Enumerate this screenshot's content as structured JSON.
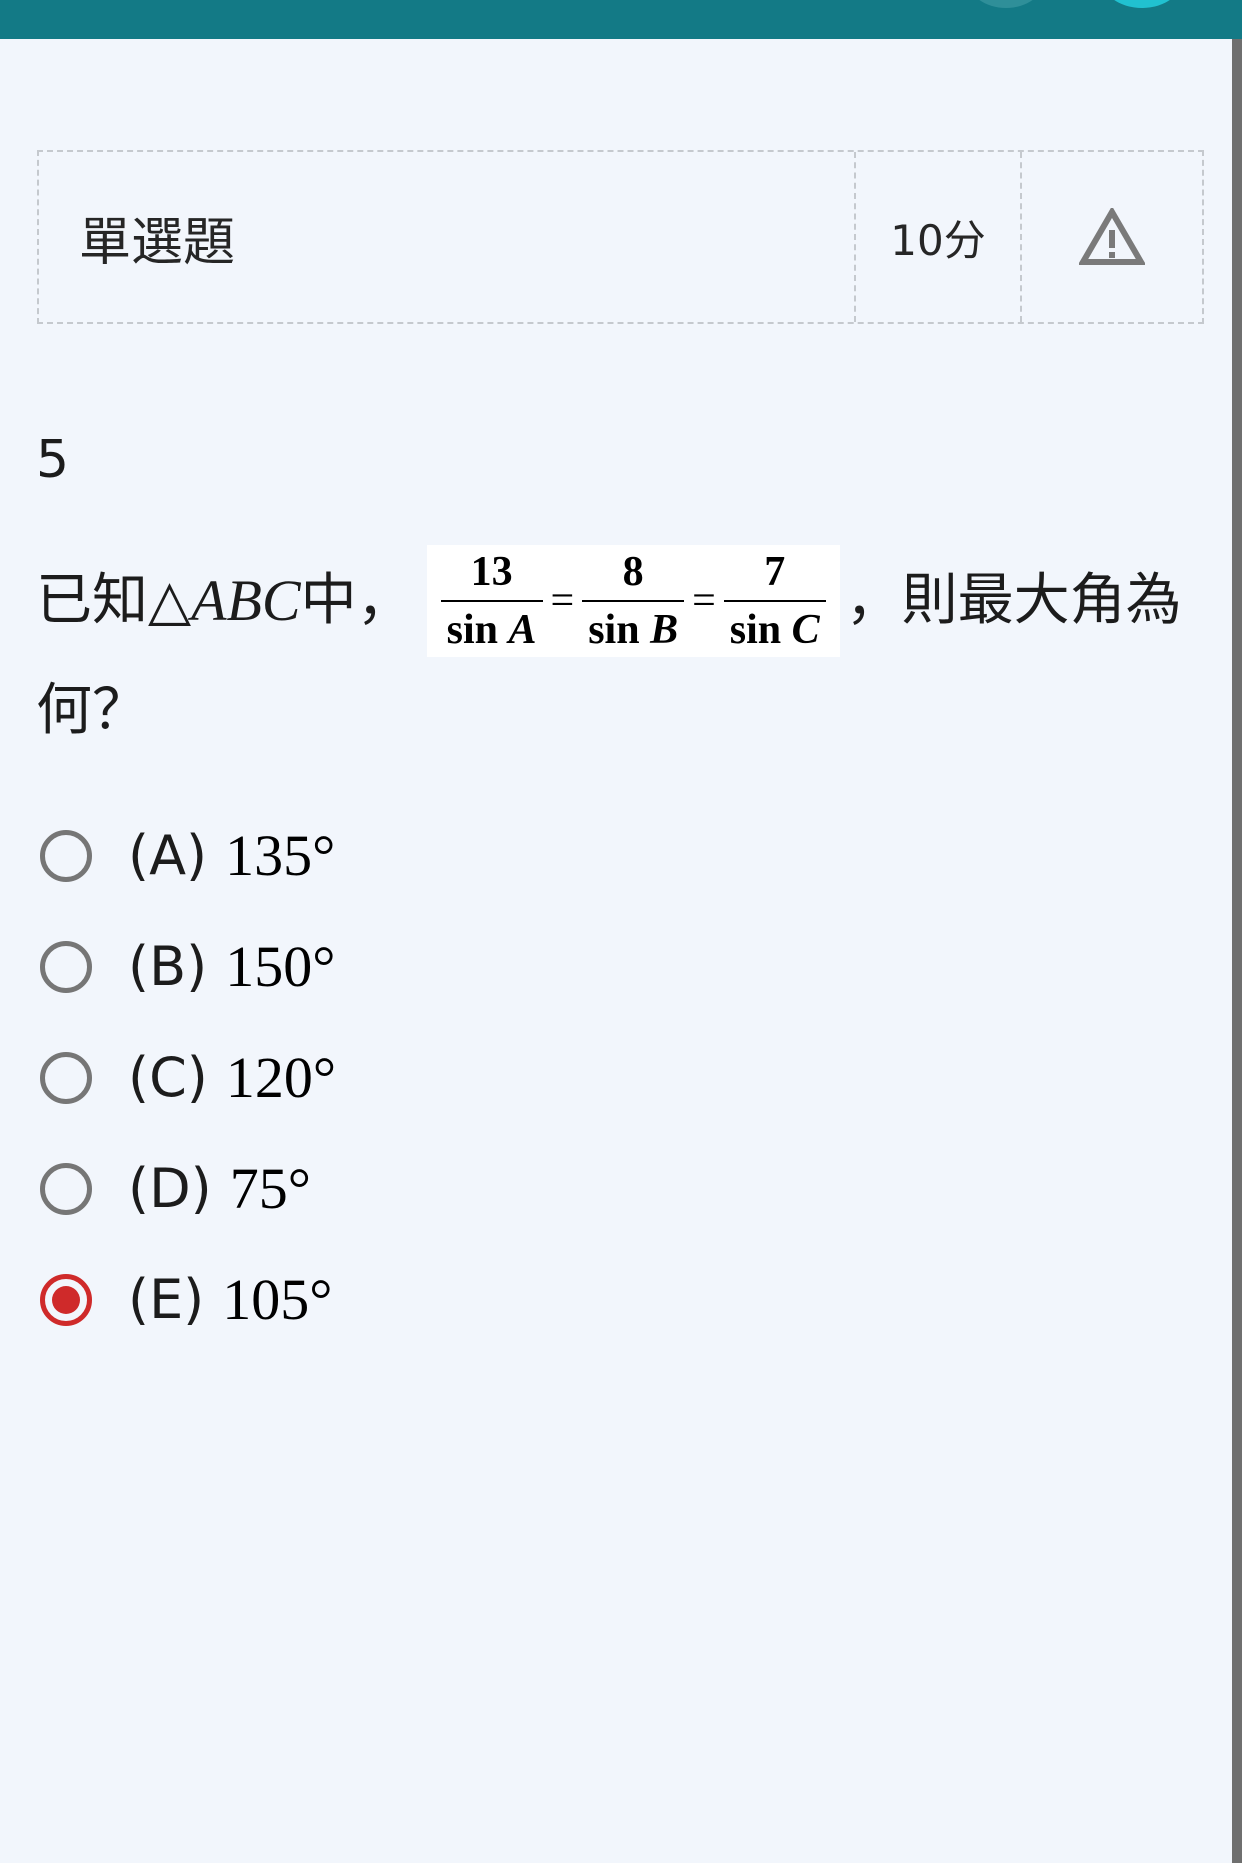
{
  "top_bar": {
    "accent_color": "#137a86"
  },
  "question_header": {
    "type_label": "單選題",
    "score": "10分",
    "report_icon": "warning-triangle-icon"
  },
  "question": {
    "number": "5",
    "text_prefix": "已知",
    "triangle_symbol": "△",
    "triangle_name": "ABC",
    "text_mid": "中，",
    "formula": {
      "fractions": [
        {
          "numerator": "13",
          "denominator_fn": "sin",
          "denominator_var": "A"
        },
        {
          "numerator": "8",
          "denominator_fn": "sin",
          "denominator_var": "B"
        },
        {
          "numerator": "7",
          "denominator_fn": "sin",
          "denominator_var": "C"
        }
      ],
      "equals": "="
    },
    "text_suffix_line1": "，則最大角為",
    "text_line2": "何？"
  },
  "options": [
    {
      "label": "(A)",
      "value": "135°",
      "selected": false
    },
    {
      "label": "(B)",
      "value": "150°",
      "selected": false
    },
    {
      "label": "(C)",
      "value": "120°",
      "selected": false
    },
    {
      "label": "(D)",
      "value": "75°",
      "selected": false
    },
    {
      "label": "(E)",
      "value": "105°",
      "selected": true
    }
  ],
  "colors": {
    "selected": "#cf2a2a",
    "unselected": "#767676",
    "background": "#f2f6fc"
  }
}
